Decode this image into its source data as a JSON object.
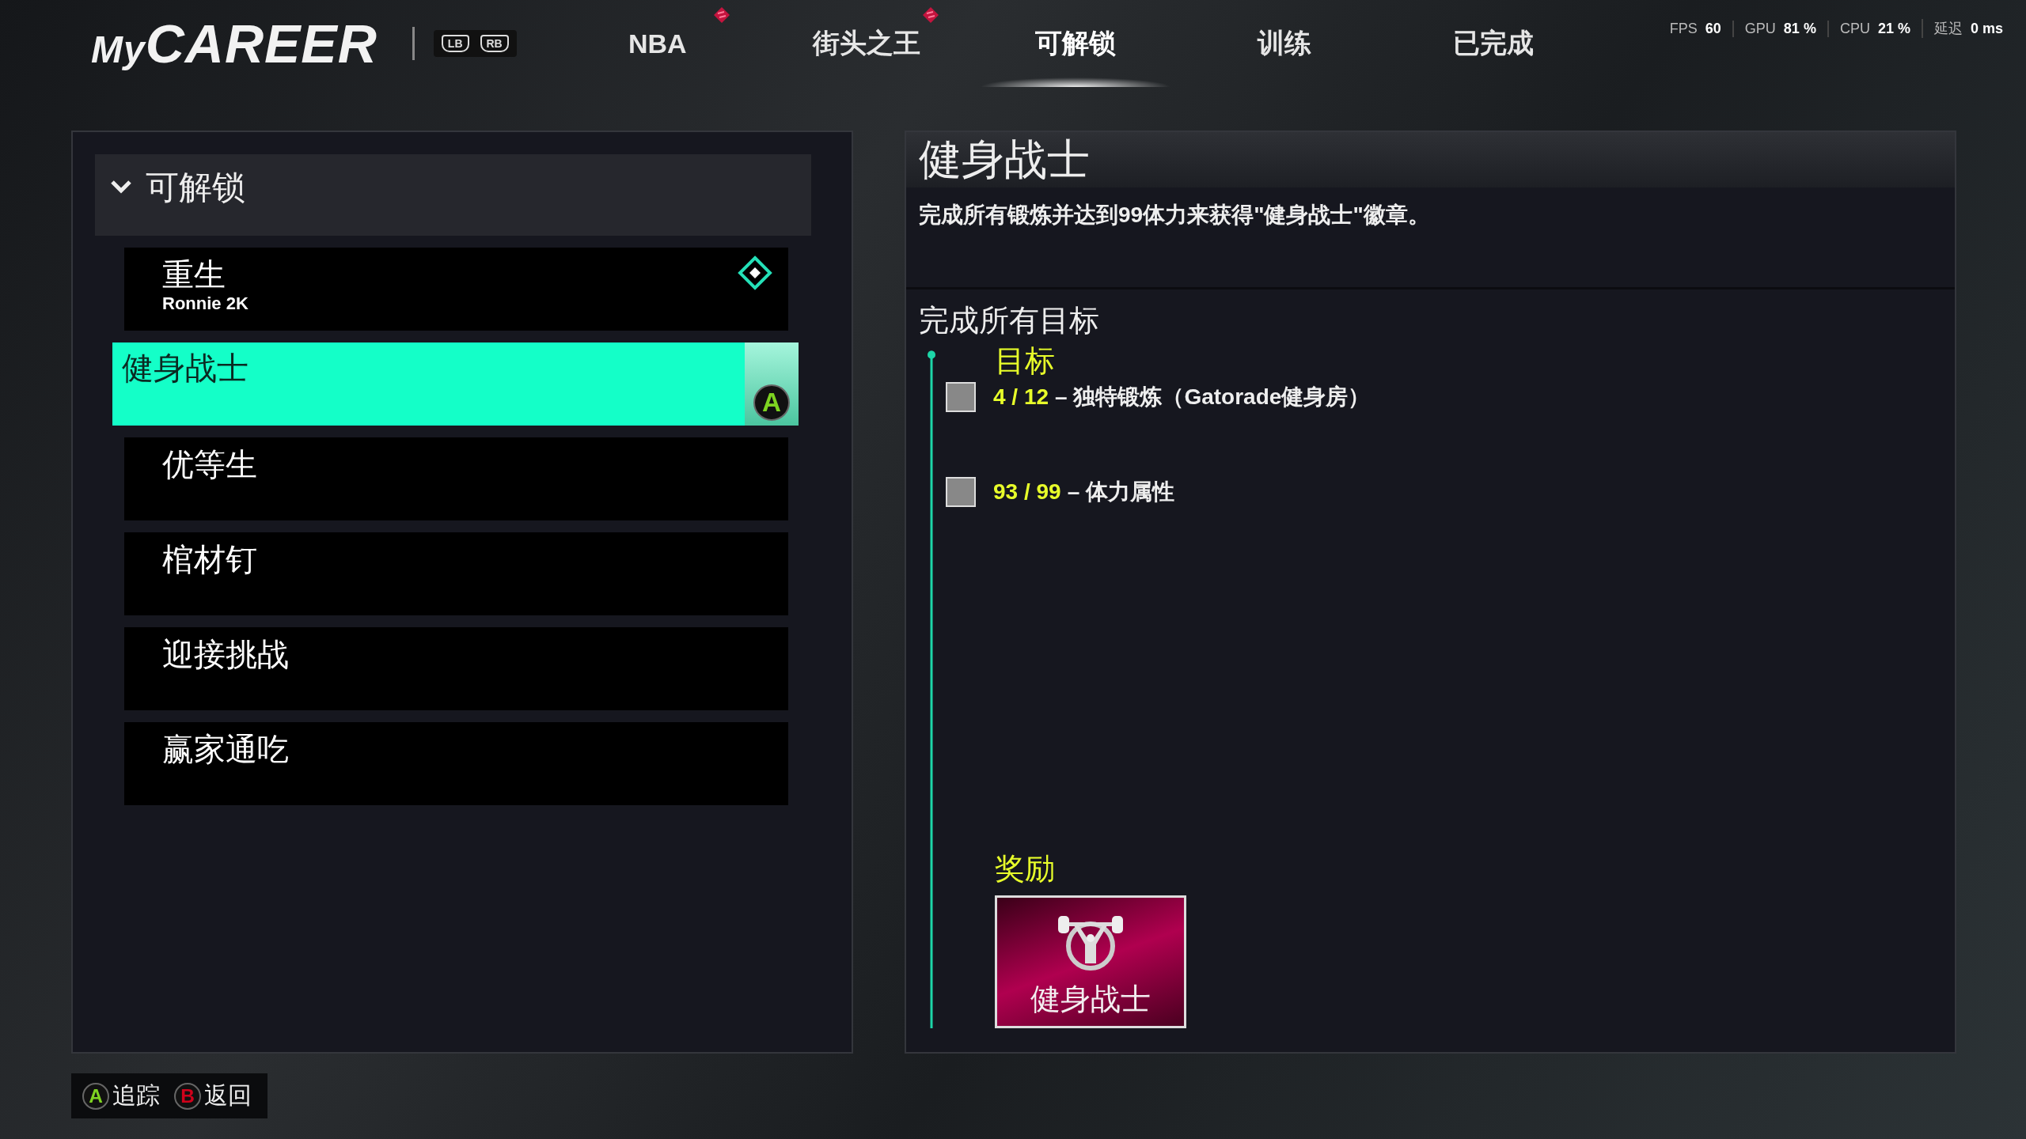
{
  "header": {
    "logo": {
      "prefix": "My",
      "main": "CAREER"
    },
    "bumpers": [
      "LB",
      "RB"
    ],
    "tabs": [
      {
        "label": "NBA",
        "selected": false,
        "alert": true
      },
      {
        "label": "街头之王",
        "selected": false,
        "alert": true
      },
      {
        "label": "可解锁",
        "selected": true,
        "alert": false
      },
      {
        "label": "训练",
        "selected": false,
        "alert": false
      },
      {
        "label": "已完成",
        "selected": false,
        "alert": false
      }
    ],
    "stats": [
      {
        "label": "FPS",
        "value": "60"
      },
      {
        "label": "GPU",
        "value": "81",
        "unit": "%"
      },
      {
        "label": "CPU",
        "value": "21",
        "unit": "%"
      },
      {
        "label": "延迟",
        "value": "0",
        "unit": "ms"
      }
    ]
  },
  "list": {
    "title": "可解锁",
    "expanded": true,
    "select_key": "A",
    "items": [
      {
        "title": "重生",
        "subtitle": "Ronnie 2K",
        "tracked": true,
        "selected": false
      },
      {
        "title": "健身战士",
        "tracked": false,
        "selected": true
      },
      {
        "title": "优等生",
        "tracked": false,
        "selected": false
      },
      {
        "title": "棺材钉",
        "tracked": false,
        "selected": false
      },
      {
        "title": "迎接挑战",
        "tracked": false,
        "selected": false
      },
      {
        "title": "赢家通吃",
        "tracked": false,
        "selected": false
      }
    ]
  },
  "detail": {
    "title": "健身战士",
    "description": "完成所有锻炼并达到99体力来获得\"健身战士\"徽章。",
    "section": "完成所有目标",
    "goals_title": "目标",
    "goals": [
      {
        "progress": "4 / 12",
        "label": "– 独特锻炼（Gatorade健身房）",
        "checked": false
      },
      {
        "progress": "93 / 99",
        "label": "– 体力属性",
        "checked": false
      }
    ],
    "reward_title": "奖励",
    "reward": {
      "name": "健身战士"
    }
  },
  "footer": {
    "buttons": [
      {
        "key": "A",
        "label": "追踪",
        "color": "#7ed321"
      },
      {
        "key": "B",
        "label": "返回",
        "color": "#d0021b"
      }
    ]
  }
}
